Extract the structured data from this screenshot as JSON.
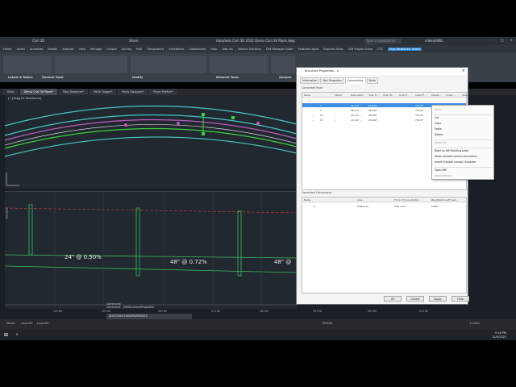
{
  "app": {
    "title": "Autodesk Civil 3D 2022   Demo Civil 3d Pipes.dwg",
    "product_label": "Civil 3D",
    "share_label": "Share",
    "search_placeholder": "Type a keyword or phrase",
    "user": "mikerbWBL"
  },
  "menu": [
    "Home",
    "Insert",
    "Annotate",
    "Modify",
    "Analyze",
    "View",
    "Manage",
    "Output",
    "Survey",
    "Rail",
    "Transparent",
    "InfraWorks",
    "Collaborate",
    "Help",
    "Add-ins",
    "Vehicle Tracking",
    "CIM Manager Suite",
    "Featured Apps",
    "Express Tools",
    "CIM Project Suite",
    "CTC",
    "Pipe Networks: Stone"
  ],
  "menu_active": "Pipe Networks: Stone",
  "ribbon_panels": [
    "Labels & Tables",
    "General Tools",
    "Modify",
    "Network Tools",
    "Analyze"
  ],
  "file_tabs": [
    "Start",
    "Demo Civil 3d Pipes*",
    "Pipe Designer*",
    "Parts Tagger*",
    "Parts Swapper*",
    "Pipes Profiler*"
  ],
  "file_tab_active": "Demo Civil 3d Pipes*",
  "viewport": {
    "label": "[+][Top][2D Wireframe]"
  },
  "profile": {
    "label_left": "24\" @ 0.50%",
    "label_mid": "48\" @ 0.72%",
    "label_right": "48\" @",
    "y_axis_label": "Elevation",
    "stations": [
      "14+00",
      "15+00",
      "16+00",
      "17+00",
      "18+00",
      "19+00",
      "20+00",
      "21+00"
    ]
  },
  "command": {
    "history_1": "Command:",
    "history_2": "Command: _EditStructureProperties",
    "input": "EDITSTRUCTUREPROPERTIES"
  },
  "status": {
    "model": "MODEL",
    "layouts": [
      "Model",
      "Layout1",
      "Layout2"
    ],
    "scale": "1:1000"
  },
  "taskbar": {
    "time": "5:16 PM",
    "date": "11/4/2021"
  },
  "dialog": {
    "title": "Structure Properties - 4",
    "tabs": [
      "Information",
      "Part Properties",
      "Connections",
      "Rules"
    ],
    "active_tab": "Connections",
    "connected_pipes_label": "Connected Pipes",
    "pipe_columns": [
      "Name",
      "Status",
      "Description",
      "Inner D...",
      "Inner W...",
      "Inner H...",
      "Invert E...",
      "Centerl...",
      "Crown ...",
      "Slope"
    ],
    "pipe_root": "4",
    "pipes": [
      {
        "name": "1",
        "desc": "24 inch ...",
        "diameter": "24.000\"",
        "invert": "710.00",
        "selected": true
      },
      {
        "name": "4",
        "desc": "48 inch ...",
        "diameter": "48.000\"",
        "invert": "710.00",
        "selected": false
      },
      {
        "name": "10",
        "desc": "24 inch ...",
        "diameter": "24.000\"",
        "invert": "710.00",
        "selected": false
      },
      {
        "name": "13",
        "desc": "24 inch ...",
        "diameter": "24.000\"",
        "invert": "776.87",
        "selected": false
      }
    ],
    "connected_catchments_label": "Connected Catchments",
    "catchment_columns": [
      "Name",
      "Area",
      "Time of Concentration",
      "Weighted Runoff Coef..."
    ],
    "catchments": [
      {
        "name": "4",
        "area": "0.86acres",
        "toc": "0.00 mins",
        "runoff": "0.000"
      }
    ],
    "buttons": [
      "OK",
      "Cancel",
      "Apply",
      "Help"
    ]
  },
  "context_menu": {
    "items": [
      {
        "label": "Undo",
        "disabled": true
      },
      {
        "label": "Cut",
        "disabled": false
      },
      {
        "label": "Copy",
        "disabled": false
      },
      {
        "label": "Paste",
        "disabled": false
      },
      {
        "label": "Delete",
        "disabled": false
      },
      {
        "label": "Select All",
        "disabled": true
      },
      {
        "label": "Right to left Reading order",
        "disabled": false
      },
      {
        "label": "Show Unicode control characters",
        "disabled": false
      },
      {
        "label": "Insert Unicode control character",
        "disabled": false
      },
      {
        "label": "Open IME",
        "disabled": false
      },
      {
        "label": "Reconversion",
        "disabled": true
      }
    ]
  },
  "colors": {
    "accent": "#2d8ad8",
    "pipe_green": "#3bd33b",
    "road_cyan": "#46c7c7",
    "pipe_magenta": "#c05cc0",
    "profile_green": "#3bbf5a",
    "ground_red": "#d04040"
  }
}
